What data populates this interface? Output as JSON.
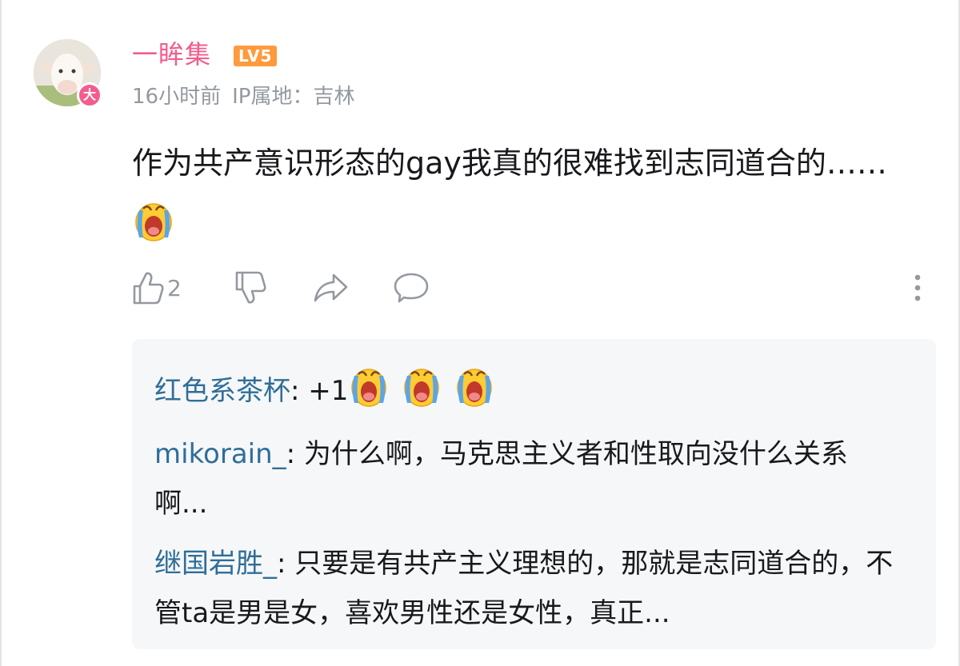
{
  "comment": {
    "avatar_badge": "大",
    "username": "一眸集",
    "level": "LV5",
    "time": "16小时前",
    "ip_location": "IP属地：吉林",
    "text": "作为共产意识形态的gay我真的很难找到志同道合的……",
    "emoji": "crying-face-emoji",
    "like_count": "2"
  },
  "replies": [
    {
      "name": "红色系茶杯",
      "separator": ": ",
      "text": "+1",
      "emoji_count": 3
    },
    {
      "name": "mikorain_",
      "separator": ": ",
      "text": "为什么啊，马克思主义者和性取向没什么关系啊..."
    },
    {
      "name": "继国岩胜_",
      "separator": ": ",
      "text": "只要是有共产主义理想的，那就是志同道合的，不管ta是男是女，喜欢男性还是女性，真正..."
    }
  ],
  "icons": {
    "like": "thumbs-up-icon",
    "dislike": "thumbs-down-icon",
    "share": "share-icon",
    "reply": "comment-bubble-icon",
    "more": "more-vertical-icon"
  },
  "colors": {
    "username": "#f25d8e",
    "level_badge": "#ff9a3d",
    "meta": "#9499a0",
    "reply_name": "#2f6e99",
    "reply_panel_bg": "#f6f7f8"
  }
}
